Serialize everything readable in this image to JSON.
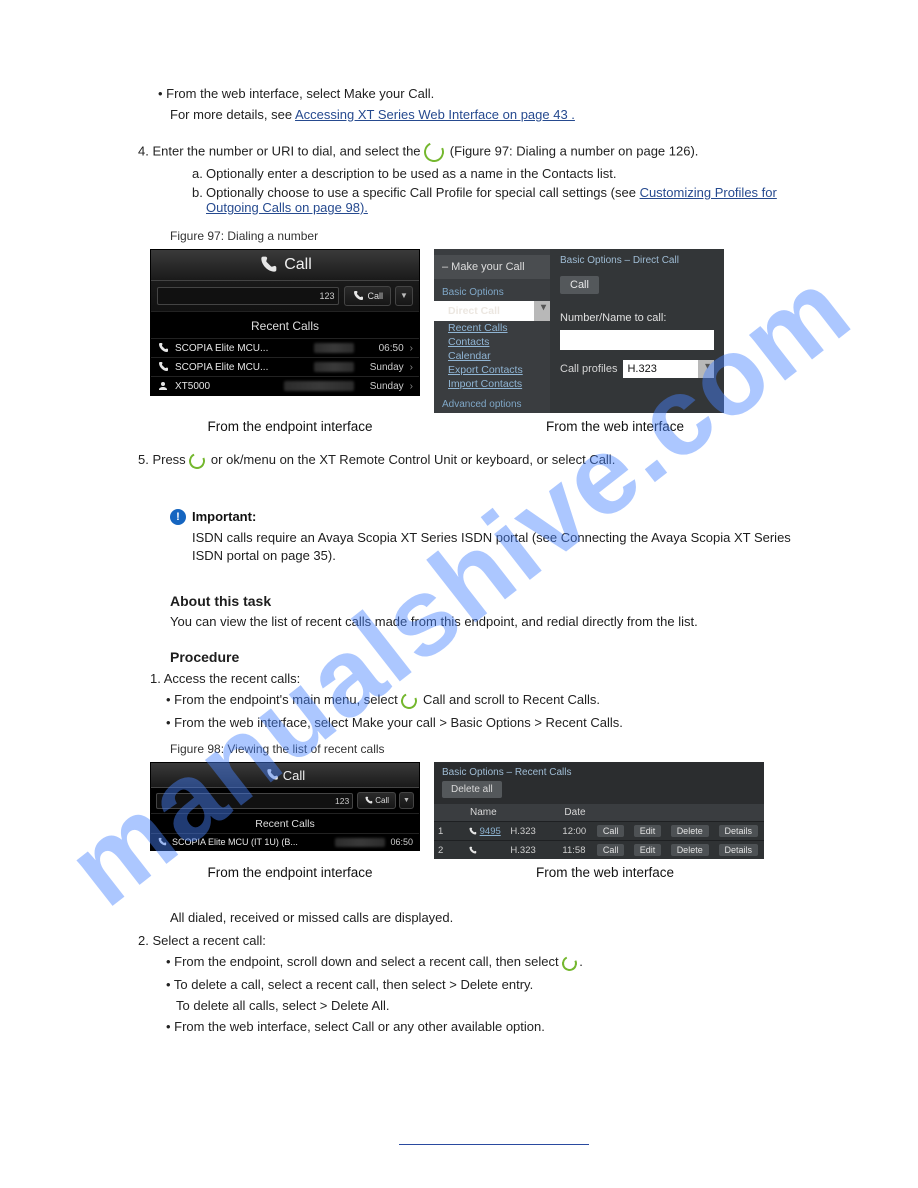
{
  "watermark": "manualshive.com",
  "steps": {
    "s3": "• From the web interface, select Make your Call.",
    "s3_more": "For more details, see",
    "s3_more_ref": "Accessing XT Series Web Interface on page 43 .",
    "s4": "4. Enter the number or URI to dial, and select the",
    "s4_suffix": "(Figure 97: Dialing a number on page 126).",
    "s4a_marker": "a.",
    "s4a": "Optionally enter a description to be used as a name in the Contacts list.",
    "s4b_marker": "b.",
    "s4b": "Optionally choose to use a specific Call Profile for special call settings (see",
    "s4b_ref": "Customizing Profiles for Outgoing Calls on page 98)."
  },
  "figureA": {
    "label": "Figure 97: Dialing a number",
    "endpoint": {
      "title": "Call",
      "fieldValue": "123",
      "callButton": "Call",
      "section": "Recent Calls",
      "rows": [
        {
          "name": "SCOPIA Elite MCU...",
          "time": "06:50"
        },
        {
          "name": "SCOPIA Elite MCU...",
          "time": "Sunday"
        },
        {
          "name": "XT5000",
          "time": "Sunday"
        }
      ],
      "caption": "From the endpoint interface"
    },
    "web": {
      "tab": "– Make your Call",
      "grp1": "Basic Options",
      "items": [
        "Direct Call",
        "Recent Calls",
        "Contacts",
        "Calendar",
        "Export Contacts",
        "Import Contacts"
      ],
      "grp2": "Advanced options",
      "crumb": "Basic Options – Direct Call",
      "callBtn": "Call",
      "label1": "Number/Name to call:",
      "label2": "Call profiles",
      "profile": "H.323",
      "caption": "From the web interface"
    }
  },
  "step5": "5. Press ",
  "step5_end": " or ok/menu on the XT Remote Control Unit or keyboard, or select Call.",
  "notice": {
    "title": "Important:",
    "body": "ISDN calls require an Avaya Scopia XT Series ISDN portal (see Connecting the Avaya Scopia XT Series ISDN portal on page 35)."
  },
  "aboutHead": "About this task",
  "aboutBody": "You can view the list of recent calls made from this endpoint, and redial directly from the list.",
  "procHead": "Procedure",
  "proc1": "1. Access the recent calls:",
  "proc1a": "• From the endpoint's main menu, select ",
  "proc1a_label": "Call",
  "proc1a_end": " and scroll to Recent Calls.",
  "proc1b": "• From the web interface, select Make your call > Basic Options > Recent Calls.",
  "figureB": {
    "label": "Figure 98: Viewing the list of recent calls",
    "endpoint2": {
      "title": "Call",
      "fieldValue": "123",
      "callButton": "Call",
      "section": "Recent Calls",
      "row": {
        "name": "SCOPIA Elite MCU (IT 1U) (B...",
        "time": "06:50"
      },
      "caption": "From the endpoint interface"
    },
    "recweb": {
      "crumb": "Basic Options – Recent Calls",
      "deleteAll": "Delete all",
      "headers": [
        "Name",
        "Date"
      ],
      "rows": [
        {
          "idx": "1",
          "name": "9495",
          "proto": "H.323",
          "time": "12:00"
        },
        {
          "idx": "2",
          "name": "",
          "proto": "H.323",
          "time": "11:58"
        }
      ],
      "btns": [
        "Call",
        "Edit",
        "Delete",
        "Details"
      ],
      "caption": "From the web interface"
    }
  },
  "closer1": "All dialed, received or missed calls are displayed.",
  "closer2": "2. Select a recent call:",
  "closer2a": "• From the endpoint, scroll down and select a recent call, then select",
  "closer2c": "• To delete a call, select a recent call, then select   > Delete entry.",
  "closer2c2": "To delete all calls, select   > Delete All.",
  "closer2d": "• From the web interface, select Call or any other available option."
}
